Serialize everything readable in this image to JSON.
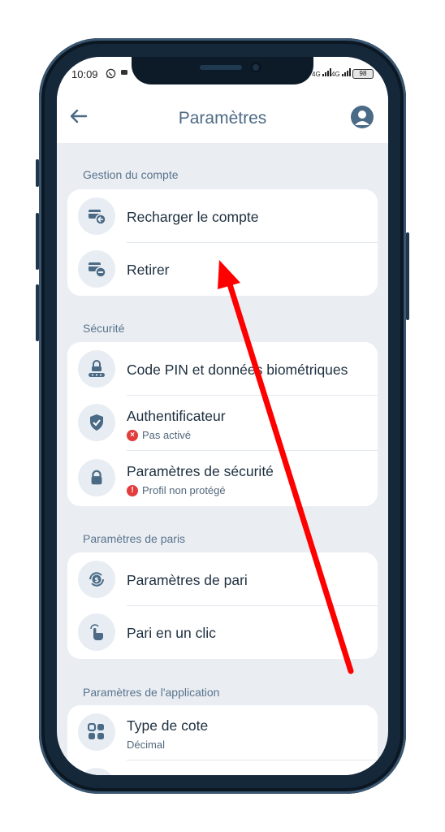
{
  "status_bar": {
    "time": "10:09",
    "battery": "98",
    "network1": "4G",
    "network2": "4G"
  },
  "header": {
    "title": "Paramètres"
  },
  "sections": [
    {
      "title": "Gestion du compte",
      "items": [
        {
          "label": "Recharger le compte",
          "icon": "deposit-card-icon"
        },
        {
          "label": "Retirer",
          "icon": "withdraw-card-icon"
        }
      ]
    },
    {
      "title": "Sécurité",
      "items": [
        {
          "label": "Code PIN et données biométriques",
          "icon": "pin-lock-icon"
        },
        {
          "label": "Authentificateur",
          "sub": "Pas activé",
          "icon": "shield-check-icon"
        },
        {
          "label": "Paramètres de sécurité",
          "sub": "Profil non protégé",
          "icon": "padlock-icon"
        }
      ]
    },
    {
      "title": "Paramètres de paris",
      "items": [
        {
          "label": "Paramètres de pari",
          "icon": "coin-settings-icon"
        },
        {
          "label": "Pari en un clic",
          "icon": "tap-finger-icon"
        }
      ]
    },
    {
      "title": "Paramètres de l'application",
      "items": [
        {
          "label": "Type de cote",
          "sub": "Décimal",
          "icon": "grid-icon"
        }
      ]
    }
  ],
  "colors": {
    "accent": "#4a6a86",
    "background": "#eaeef3",
    "annotation_arrow": "#ff0000",
    "error": "#e23c3c"
  }
}
